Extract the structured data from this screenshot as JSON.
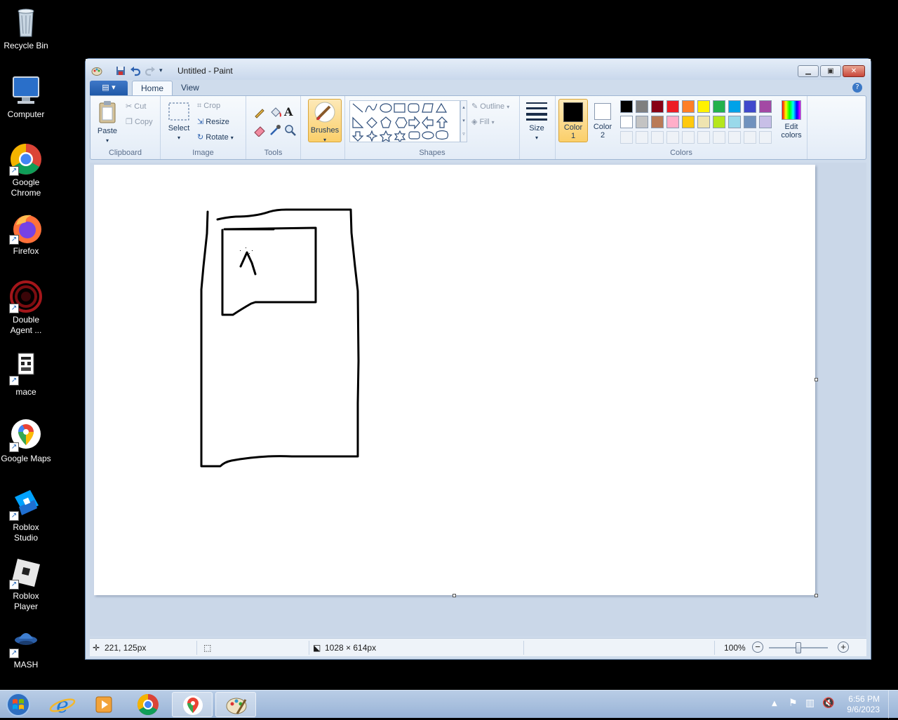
{
  "desktop": {
    "icons": [
      {
        "label": "Recycle Bin"
      },
      {
        "label": "Computer"
      },
      {
        "label": "Google Chrome"
      },
      {
        "label": "Firefox"
      },
      {
        "label": "Double Agent ..."
      },
      {
        "label": "mace"
      },
      {
        "label": "Google Maps"
      },
      {
        "label": "Roblox Studio"
      },
      {
        "label": "Roblox Player"
      },
      {
        "label": "MASH"
      }
    ]
  },
  "window": {
    "title": "Untitled - Paint",
    "tabs": {
      "home": "Home",
      "view": "View"
    },
    "help": "?"
  },
  "ribbon": {
    "clipboard": {
      "group": "Clipboard",
      "paste": "Paste",
      "cut": "Cut",
      "copy": "Copy"
    },
    "image": {
      "group": "Image",
      "select": "Select",
      "crop": "Crop",
      "resize": "Resize",
      "rotate": "Rotate"
    },
    "tools": {
      "group": "Tools",
      "text_tool": "A"
    },
    "brushes": "Brushes",
    "shapes": {
      "group": "Shapes",
      "outline": "Outline",
      "fill": "Fill"
    },
    "size": "Size",
    "colors": {
      "group": "Colors",
      "color1": "Color\n1",
      "color2": "Color\n2",
      "edit": "Edit\ncolors",
      "color1_value": "#000000",
      "color2_value": "#ffffff",
      "palette_row1": [
        "#000000",
        "#7f7f7f",
        "#880015",
        "#ed1c24",
        "#ff7f27",
        "#fff200",
        "#22b14c",
        "#00a2e8",
        "#3f48cc",
        "#a349a4"
      ],
      "palette_row2": [
        "#ffffff",
        "#c3c3c3",
        "#b97a57",
        "#ffaec9",
        "#ffc90e",
        "#efe4b0",
        "#b5e61d",
        "#99d9ea",
        "#7092be",
        "#c8bfe7"
      ]
    }
  },
  "status": {
    "cursor": "221, 125px",
    "canvas_size": "1028 × 614px",
    "zoom": "100%"
  },
  "taskbar": {
    "time": "6:56 PM",
    "date": "9/6/2023"
  }
}
